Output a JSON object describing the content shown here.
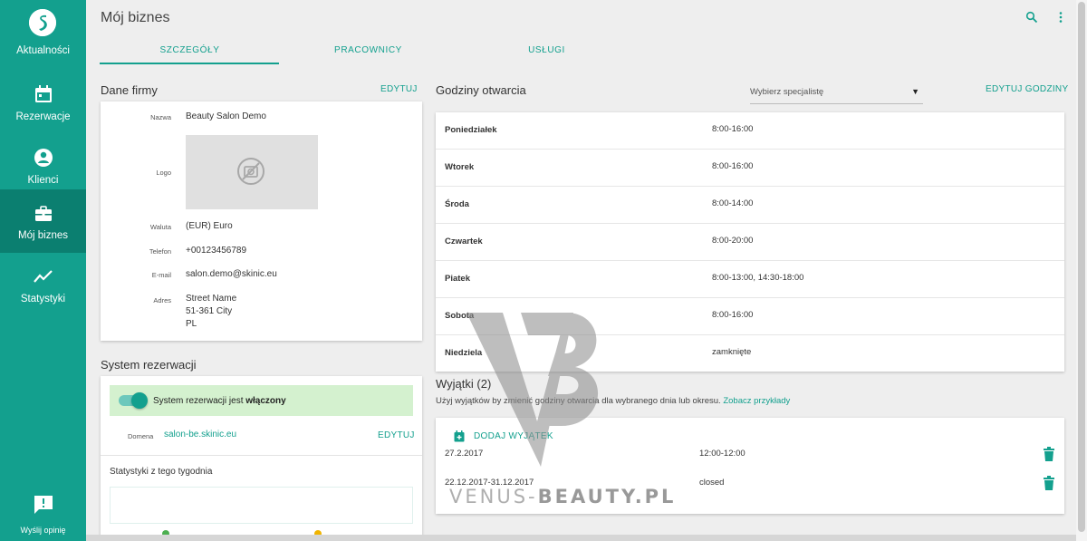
{
  "sidebar": {
    "logo_label": "Aktualności",
    "items": [
      {
        "label": "Rezerwacje",
        "icon": "calendar-icon"
      },
      {
        "label": "Klienci",
        "icon": "person-icon"
      },
      {
        "label": "Mój biznes",
        "icon": "briefcase-icon",
        "active": true
      },
      {
        "label": "Statystyki",
        "icon": "trend-icon"
      }
    ],
    "feedback_label": "Wyślij opinię"
  },
  "header": {
    "title": "Mój biznes",
    "tabs": [
      {
        "label": "SZCZEGÓŁY",
        "active": true
      },
      {
        "label": "PRACOWNICY"
      },
      {
        "label": "USŁUGI"
      }
    ]
  },
  "company": {
    "title": "Dane firmy",
    "edit_label": "EDYTUJ",
    "fields": {
      "name_label": "Nazwa",
      "name": "Beauty Salon Demo",
      "logo_label": "Logo",
      "currency_label": "Waluta",
      "currency": "(EUR) Euro",
      "phone_label": "Telefon",
      "phone": "+00123456789",
      "email_label": "E-mail",
      "email": "salon.demo@skinic.eu",
      "address_label": "Adres",
      "address_line1": "Street Name",
      "address_line2": "51-361 City",
      "address_line3": "PL"
    }
  },
  "booking": {
    "title": "System rezerwacji",
    "status_prefix": "System rezerwacji jest ",
    "status_value": "włączony",
    "domain_label": "Domena",
    "domain": "salon-be.skinic.eu",
    "edit_label": "EDYTUJ",
    "stats_title": "Statystyki z tego tygodnia"
  },
  "hours": {
    "title": "Godziny otwarcia",
    "select_placeholder": "Wybierz specjalistę",
    "edit_label": "EDYTUJ GODZINY",
    "rows": [
      {
        "day": "Poniedziałek",
        "hours": "8:00-16:00"
      },
      {
        "day": "Wtorek",
        "hours": "8:00-16:00"
      },
      {
        "day": "Środa",
        "hours": "8:00-14:00"
      },
      {
        "day": "Czwartek",
        "hours": "8:00-20:00"
      },
      {
        "day": "Piatek",
        "hours": "8:00-13:00,  14:30-18:00"
      },
      {
        "day": "Sobota",
        "hours": "8:00-16:00"
      },
      {
        "day": "Niedziela",
        "hours": "zamknięte"
      }
    ]
  },
  "exceptions": {
    "title": "Wyjątki (2)",
    "description": "Użyj wyjątków by zmienić godziny otwarcia dla wybranego dnia lub okresu.",
    "examples_link": "Zobacz przykłady",
    "add_label": "DODAJ WYJĄTEK",
    "rows": [
      {
        "date": "27.2.2017",
        "hours": "12:00-12:00"
      },
      {
        "date": "22.12.2017-31.12.2017",
        "hours": "closed"
      }
    ]
  },
  "watermark": {
    "prefix": "VENUS-",
    "suffix": "BEAUTY.PL"
  },
  "colors": {
    "accent": "#13a08e",
    "accent_dark": "#0b7f70",
    "status_bg": "#d4f1cf"
  }
}
